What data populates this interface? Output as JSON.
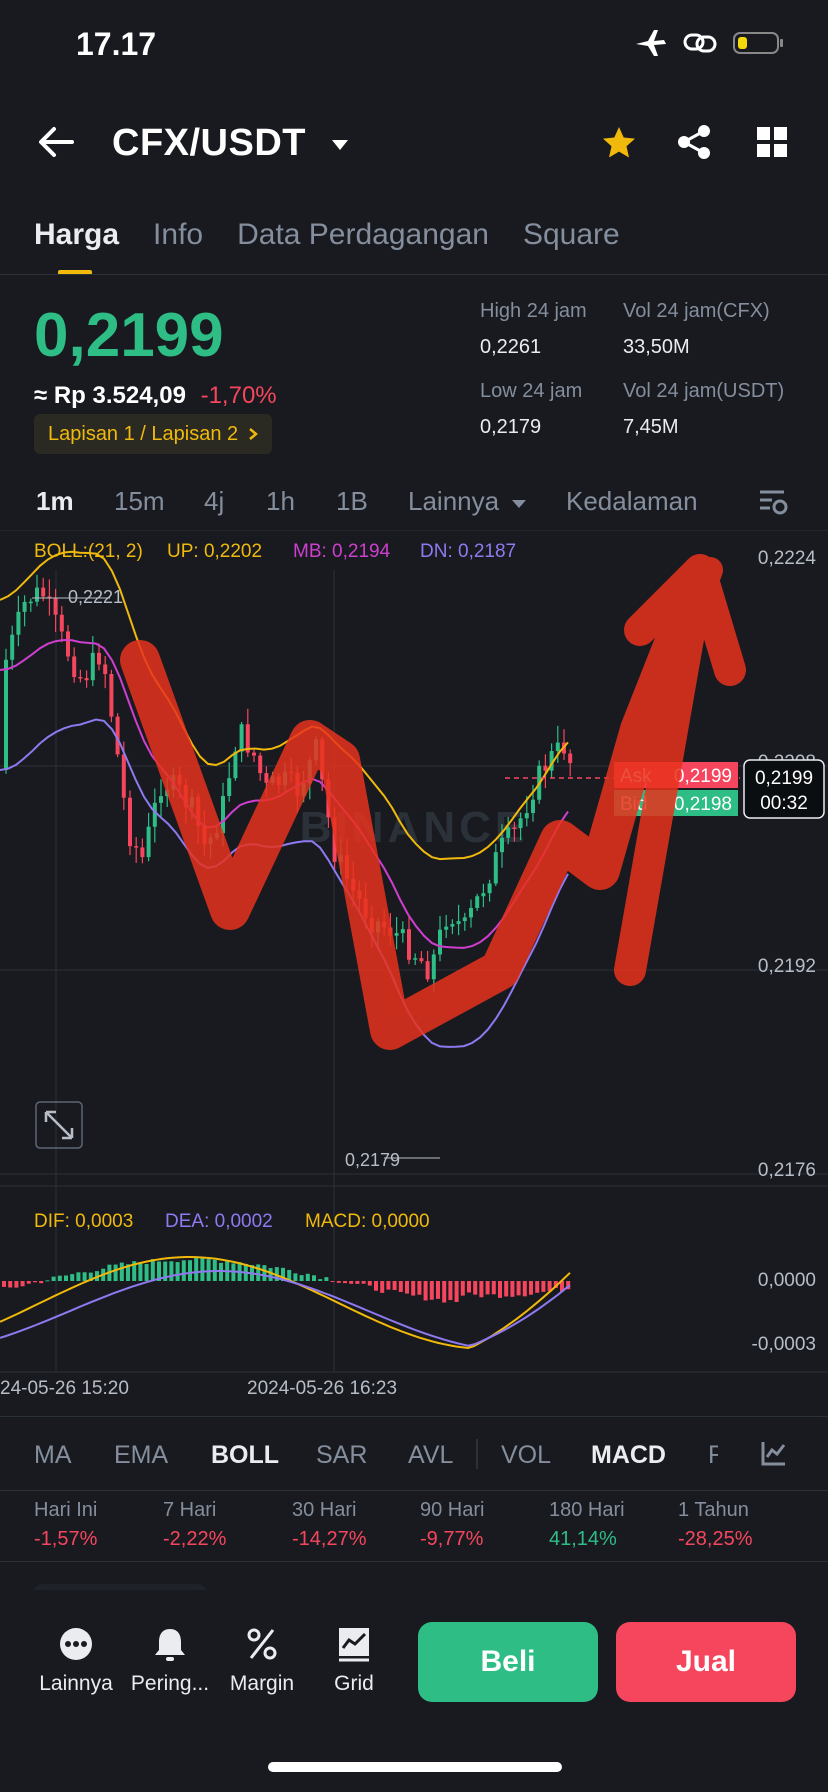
{
  "status_bar": {
    "time": "17.17",
    "icons": [
      "airplane-icon",
      "link-icon",
      "battery-icon"
    ]
  },
  "header": {
    "pair": "CFX/USDT"
  },
  "tabs": [
    {
      "label": "Harga",
      "active": true
    },
    {
      "label": "Info",
      "active": false
    },
    {
      "label": "Data Perdagangan",
      "active": false
    },
    {
      "label": "Square",
      "active": false
    }
  ],
  "price": {
    "last": "0,2199",
    "approx": "≈ Rp 3.524,09",
    "change": "-1,70%",
    "layer": "Lapisan 1 / Lapisan 2",
    "high_label": "High 24 jam",
    "high": "0,2261",
    "low_label": "Low 24 jam",
    "low": "0,2179",
    "vol_cfx_label": "Vol 24 jam(CFX)",
    "vol_cfx": "33,50M",
    "vol_usdt_label": "Vol 24 jam(USDT)",
    "vol_usdt": "7,45M"
  },
  "timeframes": {
    "items": [
      "1m",
      "15m",
      "4j",
      "1h",
      "1B"
    ],
    "active": "1m",
    "more": "Lainnya",
    "depth": "Kedalaman"
  },
  "boll": {
    "label": "BOLL:(21, 2)",
    "up": "UP: 0,2202",
    "mb": "MB: 0,2194",
    "dn": "DN: 0,2187"
  },
  "chart_data": {
    "type": "candlestick",
    "y_ticks": [
      "0,2224",
      "0,2208",
      "0,2192",
      "0,2176"
    ],
    "ylim": [
      0.2176,
      0.2224
    ],
    "high_label": "0,2221",
    "low_label": "0,2179",
    "ask_label": "Ask",
    "ask": "0,2199",
    "bid_label": "Bid",
    "bid": "0,2198",
    "current_price": "0,2199",
    "countdown": "00:32",
    "watermark": "BINANCE",
    "x_ticks": [
      "24-05-26 15:20",
      "2024-05-26 16:23"
    ],
    "macd": {
      "dif": "DIF: 0,0003",
      "dea": "DEA: 0,0002",
      "macd": "MACD: 0,0000",
      "y_ticks": [
        "0,0000",
        "-0,0003"
      ]
    }
  },
  "indicators": {
    "items": [
      "MA",
      "EMA",
      "BOLL",
      "SAR",
      "AVL",
      "VOL",
      "MACD",
      "R"
    ],
    "active": [
      "BOLL",
      "MACD"
    ]
  },
  "periods": [
    {
      "label": "Hari Ini",
      "value": "-1,57%"
    },
    {
      "label": "7 Hari",
      "value": "-2,22%"
    },
    {
      "label": "30 Hari",
      "value": "-14,27%"
    },
    {
      "label": "90 Hari",
      "value": "-9,77%"
    },
    {
      "label": "180 Hari",
      "value": "41,14%"
    },
    {
      "label": "1 Tahun",
      "value": "-28,25%"
    }
  ],
  "bottom": {
    "more": "Lainnya",
    "alert": "Pering...",
    "margin": "Margin",
    "grid": "Grid",
    "buy": "Beli",
    "sell": "Jual"
  },
  "colors": {
    "up": "#2ebd85",
    "down": "#f6465d",
    "accent": "#f0b90b",
    "annotation": "#e8321d"
  }
}
